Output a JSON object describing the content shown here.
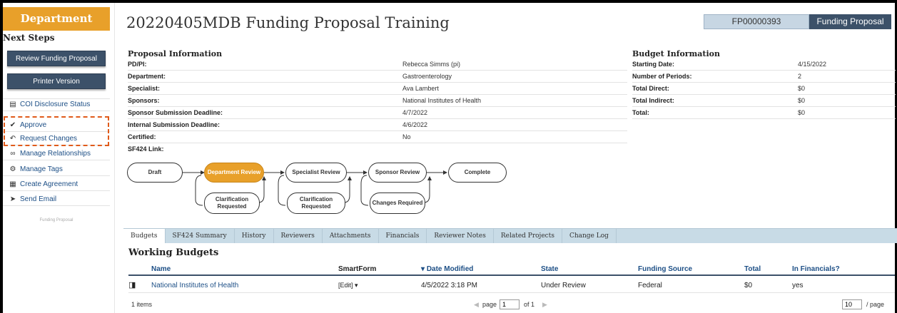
{
  "sidebar": {
    "state": "Department Review",
    "next_steps_title": "Next Steps",
    "review_button": "Review Funding Proposal",
    "printer_button": "Printer Version",
    "links": {
      "coi": "COI Disclosure Status",
      "approve": "Approve",
      "request_changes": "Request Changes",
      "manage_relationships": "Manage Relationships",
      "manage_tags": "Manage Tags",
      "create_agreement": "Create Agreement",
      "send_email": "Send Email"
    },
    "footer": "Funding Proposal",
    "highlight_color": "#e05a1a"
  },
  "header": {
    "title": "20220405MDB Funding Proposal Training",
    "id": "FP00000393",
    "type": "Funding Proposal"
  },
  "proposal": {
    "heading": "Proposal Information",
    "rows": [
      {
        "label": "PD/PI:",
        "value": "Rebecca Simms (pi)"
      },
      {
        "label": "Department:",
        "value": "Gastroenterology"
      },
      {
        "label": "Specialist:",
        "value": "Ava Lambert"
      },
      {
        "label": "Sponsors:",
        "value": "National Institutes of Health"
      },
      {
        "label": "Sponsor Submission Deadline:",
        "value": "4/7/2022"
      },
      {
        "label": "Internal Submission Deadline:",
        "value": "4/6/2022"
      },
      {
        "label": "Certified:",
        "value": "No"
      },
      {
        "label": "SF424 Link:",
        "value": ""
      }
    ]
  },
  "budget": {
    "heading": "Budget Information",
    "rows": [
      {
        "label": "Starting Date:",
        "value": "4/15/2022"
      },
      {
        "label": "Number of Periods:",
        "value": "2"
      },
      {
        "label": "Total Direct:",
        "value": "$0"
      },
      {
        "label": "Total Indirect:",
        "value": "$0"
      },
      {
        "label": "Total:",
        "value": "$0"
      }
    ]
  },
  "workflow": {
    "active_color": "#e8a02a",
    "nodes": {
      "draft": "Draft",
      "dept_review": "Department Review",
      "specialist_review": "Specialist Review",
      "sponsor_review": "Sponsor Review",
      "complete": "Complete",
      "clarification_1": "Clarification Requested",
      "clarification_2": "Clarification Requested",
      "changes_required": "Changes Required"
    }
  },
  "tabs": [
    "Budgets",
    "SF424 Summary",
    "History",
    "Reviewers",
    "Attachments",
    "Financials",
    "Reviewer Notes",
    "Related Projects",
    "Change Log"
  ],
  "working_budgets": {
    "title": "Working Budgets",
    "columns": {
      "name": "Name",
      "smartform": "SmartForm",
      "date_modified": "Date Modified",
      "state": "State",
      "funding_source": "Funding Source",
      "total": "Total",
      "in_financials": "In Financials?"
    },
    "sort_indicator": "▾",
    "rows": [
      {
        "name": "National Institutes of Health",
        "smartform": "[Edit]",
        "date_modified": "4/5/2022 3:18 PM",
        "state": "Under Review",
        "funding_source": "Federal",
        "total": "$0",
        "in_financials": "yes"
      }
    ],
    "pager": {
      "items": "1 items",
      "page_label": "page",
      "page_value": "1",
      "of_label": "of 1",
      "page_size": "10",
      "per_page_label": "/ page"
    }
  }
}
